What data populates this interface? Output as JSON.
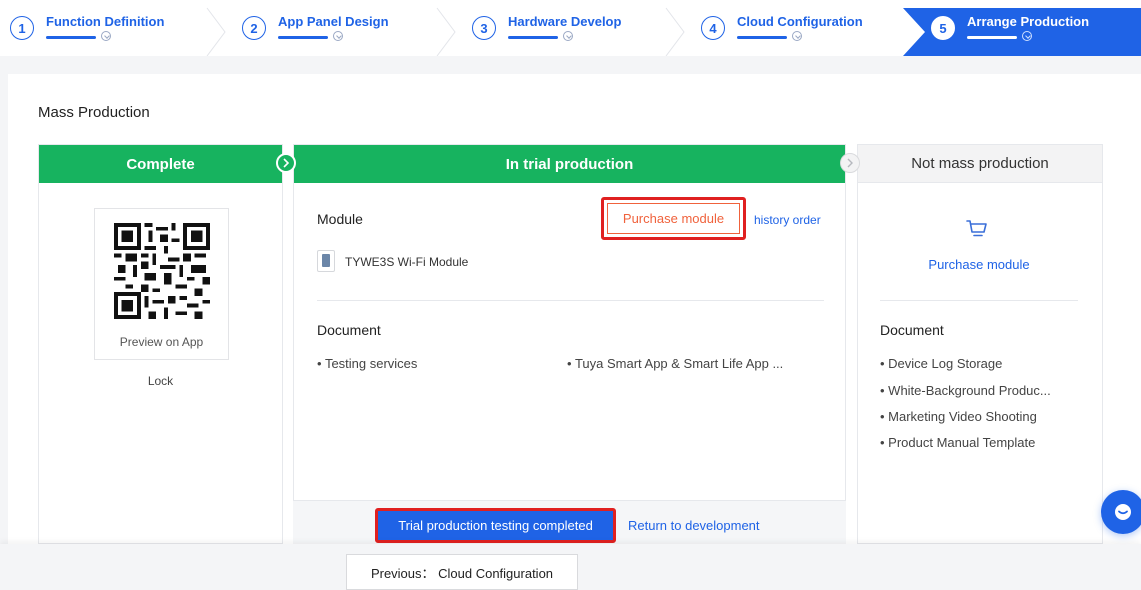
{
  "stepper": {
    "steps": [
      {
        "num": "1",
        "label": "Function Definition"
      },
      {
        "num": "2",
        "label": "App Panel Design"
      },
      {
        "num": "3",
        "label": "Hardware Develop"
      },
      {
        "num": "4",
        "label": "Cloud Configuration"
      },
      {
        "num": "5",
        "label": "Arrange Production"
      }
    ],
    "active_index": 4,
    "accent": "#1f63e6"
  },
  "page": {
    "section_title": "Mass Production"
  },
  "columns": {
    "complete": {
      "header": "Complete",
      "qr_caption": "Preview on App",
      "lock": "Lock",
      "color": "#17b35f"
    },
    "trial": {
      "header": "In trial production",
      "module_label": "Module",
      "purchase_button": "Purchase module",
      "history_link": "history order",
      "module_name": "TYWE3S Wi-Fi Module",
      "document_label": "Document",
      "documents": [
        "Testing services",
        "Tuya Smart App & Smart Life App ..."
      ],
      "trial_button": "Trial production testing completed",
      "return_link": "Return to development"
    },
    "mass": {
      "header": "Not mass production",
      "purchase_link": "Purchase module",
      "document_label": "Document",
      "documents": [
        "Device Log Storage",
        "White-Background Produc...",
        "Marketing Video Shooting",
        "Product Manual Template"
      ]
    }
  },
  "footer": {
    "previous_button": "Previous： Cloud Configuration"
  },
  "icons": {
    "cart": "shopping-cart-icon",
    "chat": "chat-icon",
    "arrow": "chevron-right-icon"
  }
}
